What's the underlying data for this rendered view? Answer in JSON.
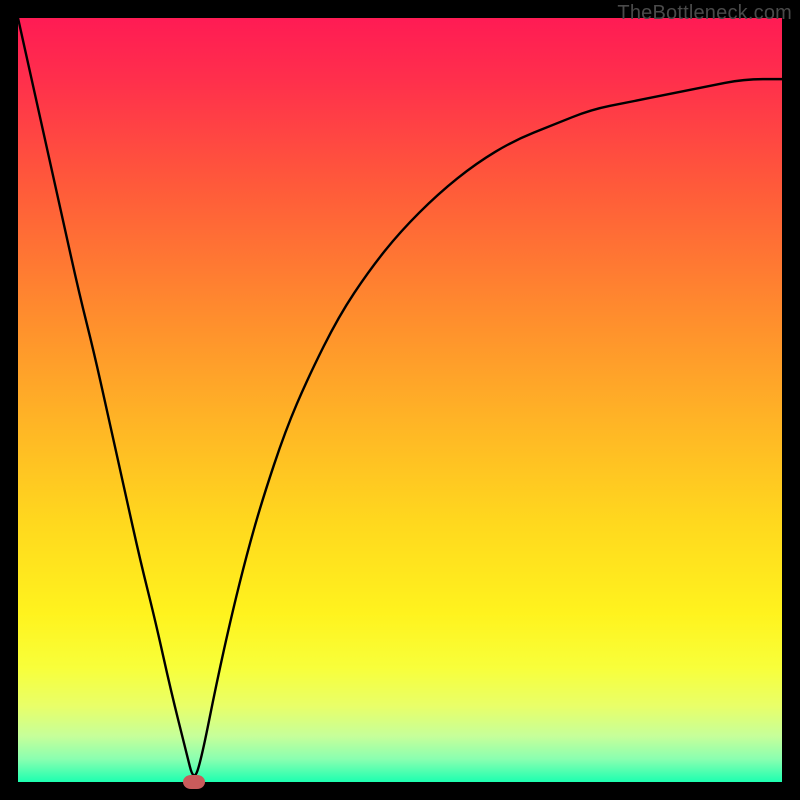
{
  "watermark": "TheBottleneck.com",
  "chart_data": {
    "type": "line",
    "title": "",
    "xlabel": "",
    "ylabel": "",
    "xlim": [
      0,
      100
    ],
    "ylim": [
      0,
      100
    ],
    "grid": false,
    "legend": false,
    "series": [
      {
        "name": "bottleneck-curve",
        "x": [
          0,
          2,
          4,
          6,
          8,
          10,
          12,
          14,
          16,
          18,
          20,
          22,
          23,
          24,
          26,
          28,
          30,
          32,
          35,
          38,
          42,
          46,
          50,
          55,
          60,
          65,
          70,
          75,
          80,
          85,
          90,
          95,
          100
        ],
        "y": [
          100,
          91,
          82,
          73,
          64,
          56,
          47,
          38,
          29,
          21,
          12,
          4,
          0,
          3,
          13,
          22,
          30,
          37,
          46,
          53,
          61,
          67,
          72,
          77,
          81,
          84,
          86,
          88,
          89,
          90,
          91,
          92,
          92
        ]
      }
    ],
    "marker": {
      "x": 23,
      "y": 0,
      "color": "#c95b5b"
    },
    "background_gradient": {
      "top": "#ff1b54",
      "bottom": "#1dffb0"
    }
  }
}
